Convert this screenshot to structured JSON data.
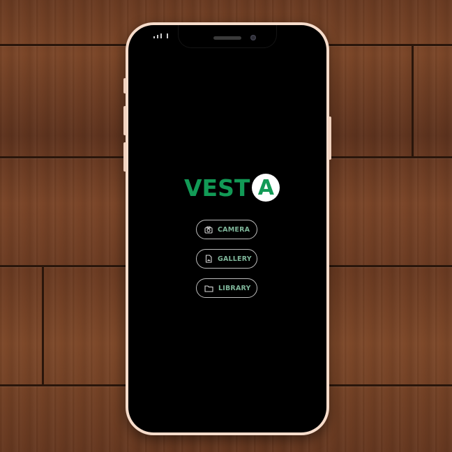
{
  "app": {
    "logo_text": "VEST",
    "logo_badge_letter": "A",
    "brand_color": "#129a56"
  },
  "menu": {
    "items": [
      {
        "label": "CAMERA",
        "icon": "camera-icon"
      },
      {
        "label": "GALLERY",
        "icon": "image-file-icon"
      },
      {
        "label": "LIBRARY",
        "icon": "folder-icon"
      }
    ]
  },
  "device": {
    "frame_color": "#f6dccb",
    "screen_color": "#000000"
  }
}
